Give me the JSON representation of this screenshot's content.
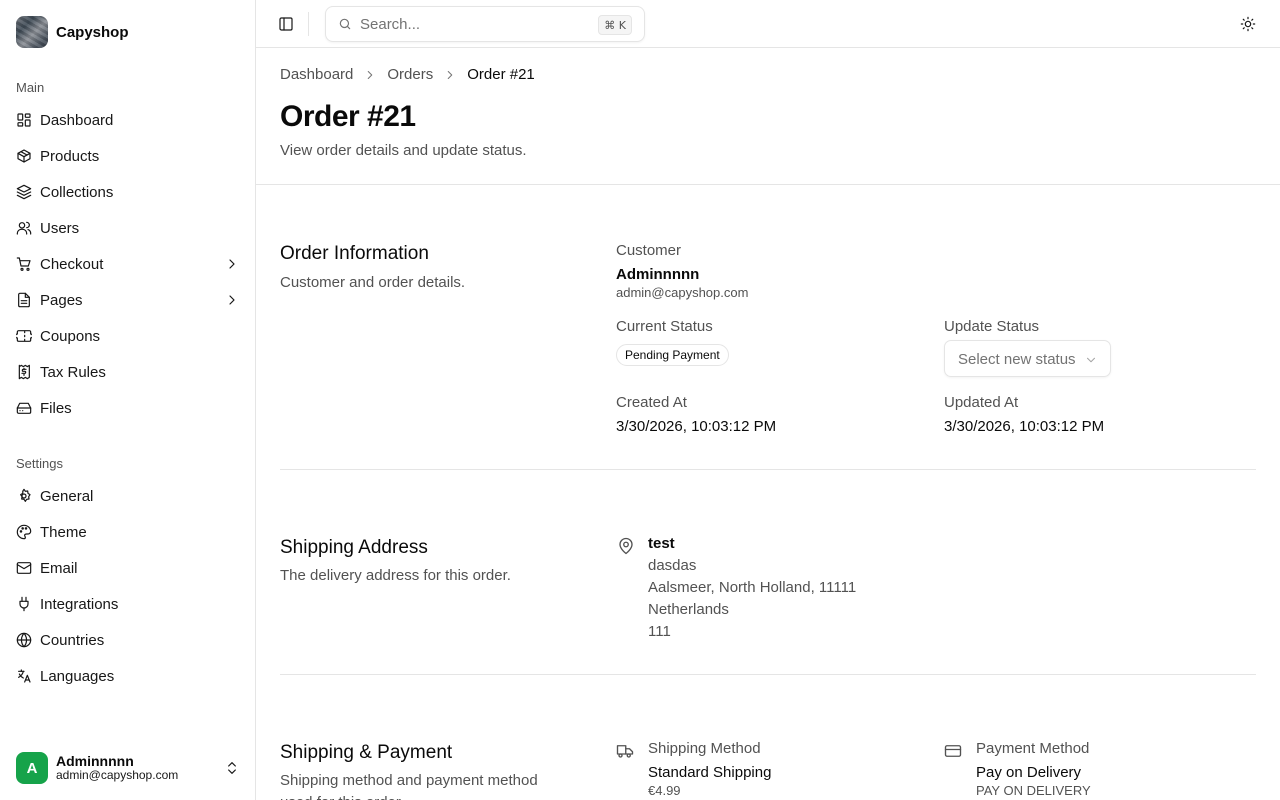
{
  "app": {
    "brand_name": "Capyshop"
  },
  "sidebar": {
    "main_label": "Main",
    "main_items": [
      {
        "label": "Dashboard",
        "icon": "layout-dashboard-icon"
      },
      {
        "label": "Products",
        "icon": "package-icon"
      },
      {
        "label": "Collections",
        "icon": "layers-icon"
      },
      {
        "label": "Users",
        "icon": "users-icon"
      },
      {
        "label": "Checkout",
        "icon": "shopping-cart-icon",
        "expandable": true
      },
      {
        "label": "Pages",
        "icon": "file-text-icon",
        "expandable": true
      },
      {
        "label": "Coupons",
        "icon": "ticket-icon"
      },
      {
        "label": "Tax Rules",
        "icon": "receipt-icon"
      },
      {
        "label": "Files",
        "icon": "hard-drive-icon"
      }
    ],
    "settings_label": "Settings",
    "settings_items": [
      {
        "label": "General",
        "icon": "settings-icon"
      },
      {
        "label": "Theme",
        "icon": "palette-icon"
      },
      {
        "label": "Email",
        "icon": "mail-icon"
      },
      {
        "label": "Integrations",
        "icon": "plug-icon"
      },
      {
        "label": "Countries",
        "icon": "globe-icon"
      },
      {
        "label": "Languages",
        "icon": "languages-icon"
      }
    ],
    "user": {
      "initial": "A",
      "name": "Adminnnnn",
      "email": "admin@capyshop.com"
    }
  },
  "topbar": {
    "search_placeholder": "Search...",
    "search_shortcut": "⌘ K"
  },
  "breadcrumb": [
    "Dashboard",
    "Orders",
    "Order #21"
  ],
  "page": {
    "title": "Order #21",
    "subtitle": "View order details and update status."
  },
  "order_info": {
    "title": "Order Information",
    "description": "Customer and order details.",
    "customer_label": "Customer",
    "customer_name": "Adminnnnn",
    "customer_email": "admin@capyshop.com",
    "current_status_label": "Current Status",
    "current_status": "Pending Payment",
    "update_status_label": "Update Status",
    "update_status_placeholder": "Select new status",
    "created_label": "Created At",
    "created_value": "3/30/2026, 10:03:12 PM",
    "updated_label": "Updated At",
    "updated_value": "3/30/2026, 10:03:12 PM"
  },
  "shipping_address": {
    "title": "Shipping Address",
    "description": "The delivery address for this order.",
    "name": "test",
    "lines": [
      "dasdas",
      "Aalsmeer, North Holland, 11111",
      "Netherlands",
      "111"
    ]
  },
  "shipping_payment": {
    "title": "Shipping & Payment",
    "description": "Shipping method and payment method used for this order.",
    "shipping_label": "Shipping Method",
    "shipping_value": "Standard Shipping",
    "shipping_price": "€4.99",
    "payment_label": "Payment Method",
    "payment_value": "Pay on Delivery",
    "payment_code": "PAY ON DELIVERY"
  }
}
